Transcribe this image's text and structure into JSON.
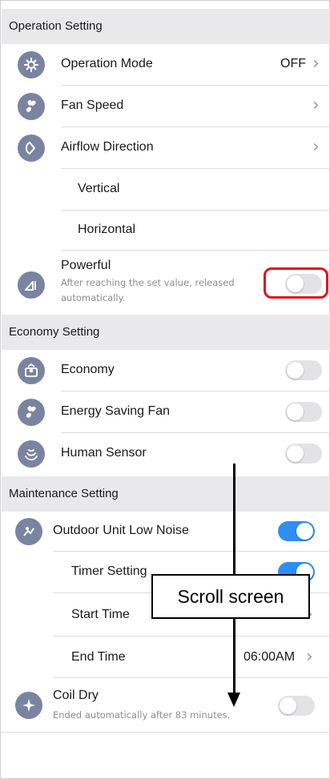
{
  "operation": {
    "header": "Operation Setting",
    "mode_label": "Operation Mode",
    "mode_value": "OFF",
    "fan_speed_label": "Fan Speed",
    "airflow_label": "Airflow Direction",
    "vertical_label": "Vertical",
    "horizontal_label": "Horizontal",
    "powerful_label": "Powerful",
    "powerful_desc": "After reaching the set value, released automatically.",
    "powerful_on": false
  },
  "economy": {
    "header": "Economy Setting",
    "economy_label": "Economy",
    "economy_on": false,
    "energy_fan_label": "Energy Saving Fan",
    "energy_fan_on": false,
    "human_sensor_label": "Human Sensor",
    "human_sensor_on": false
  },
  "maintenance": {
    "header": "Maintenance Setting",
    "outdoor_label": "Outdoor Unit Low Noise",
    "outdoor_on": true,
    "timer_label": "Timer Setting",
    "timer_on": true,
    "start_label": "Start Time",
    "end_label": "End Time",
    "end_value": "06:00AM",
    "coil_label": "Coil Dry",
    "coil_desc": "Ended automatically after 83 minutes.",
    "coil_on": false
  },
  "annotation": {
    "scroll_text": "Scroll screen"
  },
  "colors": {
    "accent": "#2f8ef0",
    "icon": "#7a84a0",
    "highlight": "#e0141c",
    "header_bg": "#e9e9ec"
  }
}
